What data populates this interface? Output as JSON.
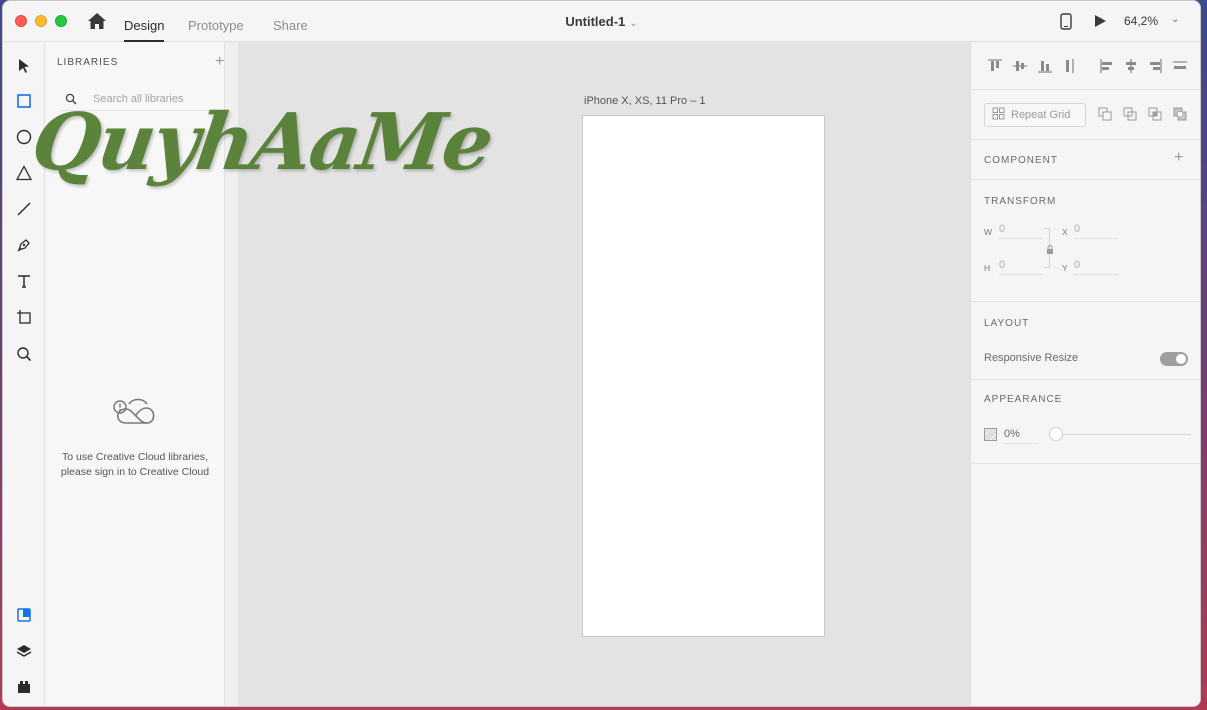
{
  "titlebar": {
    "tabs": [
      {
        "label": "Design",
        "active": true
      },
      {
        "label": "Prototype",
        "active": false
      },
      {
        "label": "Share",
        "active": false
      }
    ],
    "document_title": "Untitled-1",
    "zoom": "64,2%"
  },
  "toolbar": {
    "tools": [
      "select-tool-icon",
      "rectangle-tool-icon",
      "ellipse-tool-icon",
      "polygon-tool-icon",
      "line-tool-icon",
      "pen-tool-icon",
      "text-tool-icon",
      "artboard-tool-icon",
      "zoom-tool-icon"
    ],
    "bottom": [
      "libraries-icon",
      "layers-icon",
      "plugins-icon"
    ],
    "accent_color": "#1473e6"
  },
  "libraries": {
    "title": "LIBRARIES",
    "search_placeholder": "Search all libraries",
    "message_line1": "To use Creative Cloud libraries,",
    "message_line2": "please sign in to Creative Cloud"
  },
  "canvas": {
    "artboard_label": "iPhone X, XS, 11 Pro – 1"
  },
  "properties": {
    "repeat_grid_label": "Repeat Grid",
    "component_title": "COMPONENT",
    "transform_title": "TRANSFORM",
    "transform": {
      "w_label": "W",
      "w_value": "0",
      "h_label": "H",
      "h_value": "0",
      "x_label": "X",
      "x_value": "0",
      "y_label": "Y",
      "y_value": "0"
    },
    "layout_title": "LAYOUT",
    "responsive_resize_label": "Responsive Resize",
    "responsive_resize_on": true,
    "appearance_title": "APPEARANCE",
    "opacity_value": "0%"
  },
  "watermark": {
    "text": "QuyhAaMe"
  }
}
